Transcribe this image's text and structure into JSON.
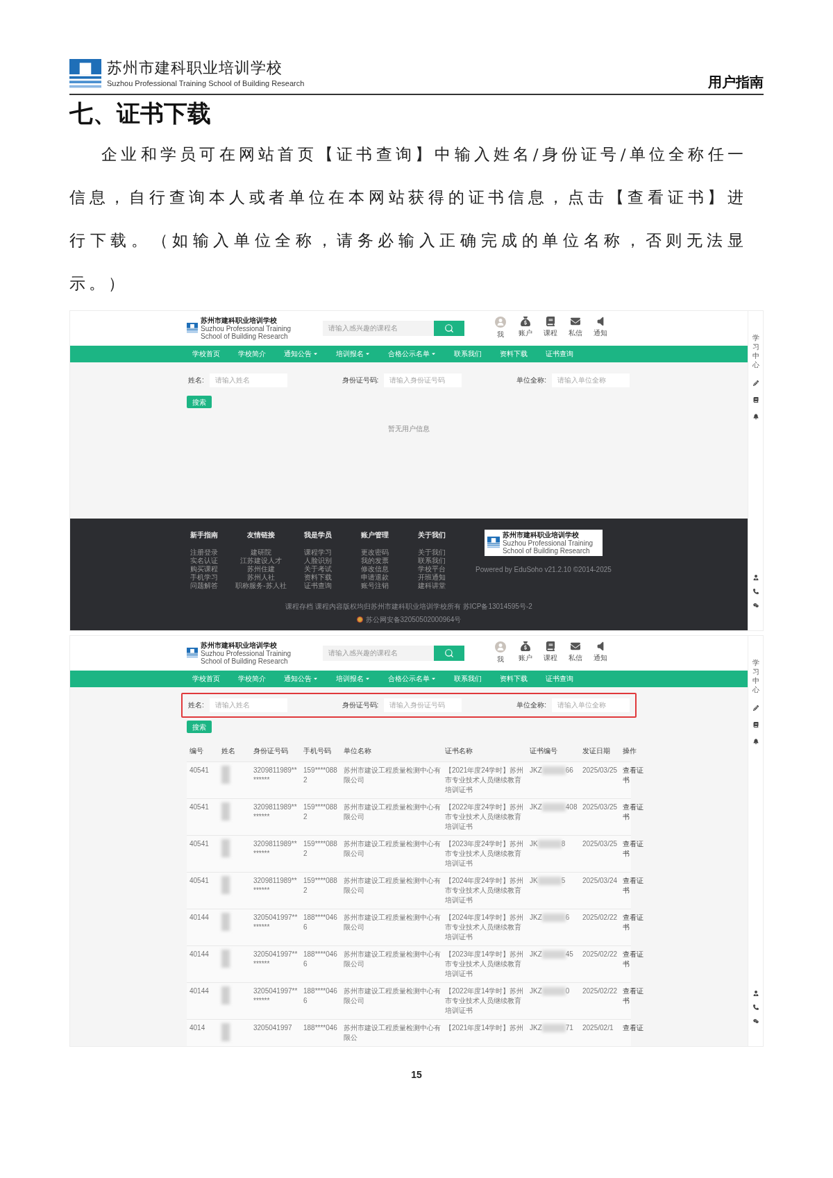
{
  "header": {
    "school_name": "苏州市建科职业培训学校",
    "school_name_en": "Suzhou Professional Training School of Building Research",
    "doc_label": "用户指南"
  },
  "heading": "七、证书下载",
  "intro": "企业和学员可在网站首页【证书查询】中输入姓名/身份证号/单位全称任一信息，自行查询本人或者单位在本网站获得的证书信息，点击【查看证书】进行下载。（如输入单位全称，请务必输入正确完成的单位名称，否则无法显示。）",
  "screenshots": [
    {
      "site_header": {
        "school_name": "苏州市建科职业培训学校",
        "school_name_en": "Suzhou Professional Training School of Building Research",
        "search_placeholder": "请输入感兴趣的课程名",
        "user_menu": [
          {
            "label": "我",
            "kind": "avatar"
          },
          {
            "label": "账户",
            "kind": "wallet"
          },
          {
            "label": "课程",
            "kind": "book"
          },
          {
            "label": "私信",
            "kind": "mail"
          },
          {
            "label": "通知",
            "kind": "speaker"
          }
        ]
      },
      "nav": [
        {
          "label": "学校首页",
          "dropdown": false
        },
        {
          "label": "学校简介",
          "dropdown": false
        },
        {
          "label": "通知公告",
          "dropdown": true
        },
        {
          "label": "培训报名",
          "dropdown": true
        },
        {
          "label": "合格公示名单",
          "dropdown": true
        },
        {
          "label": "联系我们",
          "dropdown": false
        },
        {
          "label": "资料下载",
          "dropdown": false
        },
        {
          "label": "证书查询",
          "dropdown": false
        }
      ],
      "sidebar": {
        "title": "学习中心"
      },
      "search_form": {
        "highlighted": false,
        "fields": [
          {
            "label": "姓名:",
            "placeholder": "请输入姓名"
          },
          {
            "label": "身份证号码:",
            "placeholder": "请输入身份证号码"
          },
          {
            "label": "单位全称:",
            "placeholder": "请输入单位全称"
          }
        ],
        "button": "搜索"
      },
      "empty_message": "暂无用户信息",
      "footer": {
        "columns": [
          {
            "title": "新手指南",
            "links": [
              "注册登录",
              "实名认证",
              "购买课程",
              "手机学习",
              "问题解答"
            ]
          },
          {
            "title": "友情链接",
            "links": [
              "建研院",
              "江苏建设人才",
              "苏州住建",
              "苏州人社",
              "职称服务-苏人社"
            ]
          },
          {
            "title": "我是学员",
            "links": [
              "课程学习",
              "人脸识别",
              "关于考试",
              "资料下载",
              "证书查询"
            ]
          },
          {
            "title": "账户管理",
            "links": [
              "更改密码",
              "我的发票",
              "修改信息",
              "申请退款",
              "账号注销"
            ]
          },
          {
            "title": "关于我们",
            "links": [
              "关于我们",
              "联系我们",
              "学校平台",
              "开班通知",
              "建科讲堂"
            ]
          }
        ],
        "logo_name": "苏州市建科职业培训学校",
        "logo_name_en": "Suzhou Professional Training School of Building Research",
        "powered_by": "Powered by EduSoho v21.2.10 ©2014-2025",
        "copyright": "课程存档 课程内容版权均归苏州市建科职业培训学校所有 苏ICP备13014595号-2",
        "police_record": "苏公网安备32050502000964号"
      }
    },
    {
      "site_header": {
        "school_name": "苏州市建科职业培训学校",
        "school_name_en": "Suzhou Professional Training School of Building Research",
        "search_placeholder": "请输入感兴趣的课程名",
        "user_menu": [
          {
            "label": "我",
            "kind": "avatar"
          },
          {
            "label": "账户",
            "kind": "wallet"
          },
          {
            "label": "课程",
            "kind": "book"
          },
          {
            "label": "私信",
            "kind": "mail"
          },
          {
            "label": "通知",
            "kind": "speaker"
          }
        ]
      },
      "nav": [
        {
          "label": "学校首页",
          "dropdown": false
        },
        {
          "label": "学校简介",
          "dropdown": false
        },
        {
          "label": "通知公告",
          "dropdown": true
        },
        {
          "label": "培训报名",
          "dropdown": true
        },
        {
          "label": "合格公示名单",
          "dropdown": true
        },
        {
          "label": "联系我们",
          "dropdown": false
        },
        {
          "label": "资料下载",
          "dropdown": false
        },
        {
          "label": "证书查询",
          "dropdown": false
        }
      ],
      "sidebar": {
        "title": "学习中心"
      },
      "search_form": {
        "highlighted": true,
        "fields": [
          {
            "label": "姓名:",
            "placeholder": "请输入姓名"
          },
          {
            "label": "身份证号码:",
            "placeholder": "请输入身份证号码"
          },
          {
            "label": "单位全称:",
            "placeholder": "请输入单位全称"
          }
        ],
        "button": "搜索"
      },
      "table": {
        "columns": [
          "编号",
          "姓名",
          "身份证号码",
          "手机号码",
          "单位名称",
          "证书名称",
          "证书编号",
          "发证日期",
          "操作"
        ],
        "rows": [
          {
            "no": "40541",
            "id_card": "3209811989********",
            "phone": "159****0882",
            "company": "苏州市建设工程质量检测中心有限公司",
            "certificate": "【2021年度24学时】苏州市专业技术人员继续教育培训证书",
            "cert_prefix": "JKZ",
            "cert_suffix": "66",
            "date": "2025/03/25",
            "action": "查看证书"
          },
          {
            "no": "40541",
            "id_card": "3209811989********",
            "phone": "159****0882",
            "company": "苏州市建设工程质量检测中心有限公司",
            "certificate": "【2022年度24学时】苏州市专业技术人员继续教育培训证书",
            "cert_prefix": "JKZ",
            "cert_suffix": "408",
            "date": "2025/03/25",
            "action": "查看证书"
          },
          {
            "no": "40541",
            "id_card": "3209811989********",
            "phone": "159****0882",
            "company": "苏州市建设工程质量检测中心有限公司",
            "certificate": "【2023年度24学时】苏州市专业技术人员继续教育培训证书",
            "cert_prefix": "JK",
            "cert_suffix": "8",
            "date": "2025/03/25",
            "action": "查看证书"
          },
          {
            "no": "40541",
            "id_card": "3209811989********",
            "phone": "159****0882",
            "company": "苏州市建设工程质量检测中心有限公司",
            "certificate": "【2024年度24学时】苏州市专业技术人员继续教育培训证书",
            "cert_prefix": "JK",
            "cert_suffix": "5",
            "date": "2025/03/24",
            "action": "查看证书"
          },
          {
            "no": "40144",
            "id_card": "3205041997********",
            "phone": "188****0466",
            "company": "苏州市建设工程质量检测中心有限公司",
            "certificate": "【2024年度14学时】苏州市专业技术人员继续教育培训证书",
            "cert_prefix": "JKZ",
            "cert_suffix": "6",
            "date": "2025/02/22",
            "action": "查看证书"
          },
          {
            "no": "40144",
            "id_card": "3205041997********",
            "phone": "188****0466",
            "company": "苏州市建设工程质量检测中心有限公司",
            "certificate": "【2023年度14学时】苏州市专业技术人员继续教育培训证书",
            "cert_prefix": "JKZ",
            "cert_suffix": "45",
            "date": "2025/02/22",
            "action": "查看证书"
          },
          {
            "no": "40144",
            "id_card": "3205041997********",
            "phone": "188****0466",
            "company": "苏州市建设工程质量检测中心有限公司",
            "certificate": "【2022年度14学时】苏州市专业技术人员继续教育培训证书",
            "cert_prefix": "JKZ",
            "cert_suffix": "0",
            "date": "2025/02/22",
            "action": "查看证书"
          },
          {
            "no": "4014",
            "id_card": "3205041997",
            "phone": "188****046",
            "company": "苏州市建设工程质量检测中心有限公",
            "certificate": "【2021年度14学时】苏州",
            "cert_prefix": "JKZ",
            "cert_suffix": "71",
            "date": "2025/02/1",
            "action": "查看证"
          }
        ]
      }
    }
  ],
  "page_number": "15"
}
